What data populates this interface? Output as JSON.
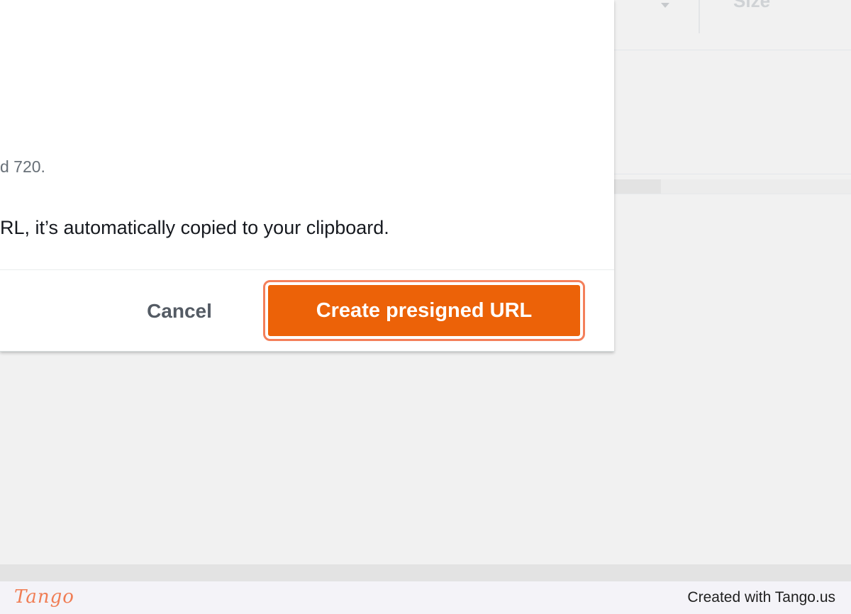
{
  "background": {
    "column_header": "Size"
  },
  "modal": {
    "helper_text_fragment": "d 720.",
    "info_text_fragment": "RL, it’s automatically copied to your clipboard.",
    "cancel_label": "Cancel",
    "primary_label": "Create presigned URL",
    "colors": {
      "primary": "#ec6208",
      "highlight": "#f47f5a"
    }
  },
  "footer": {
    "logo": "Tango",
    "credit": "Created with Tango.us"
  }
}
